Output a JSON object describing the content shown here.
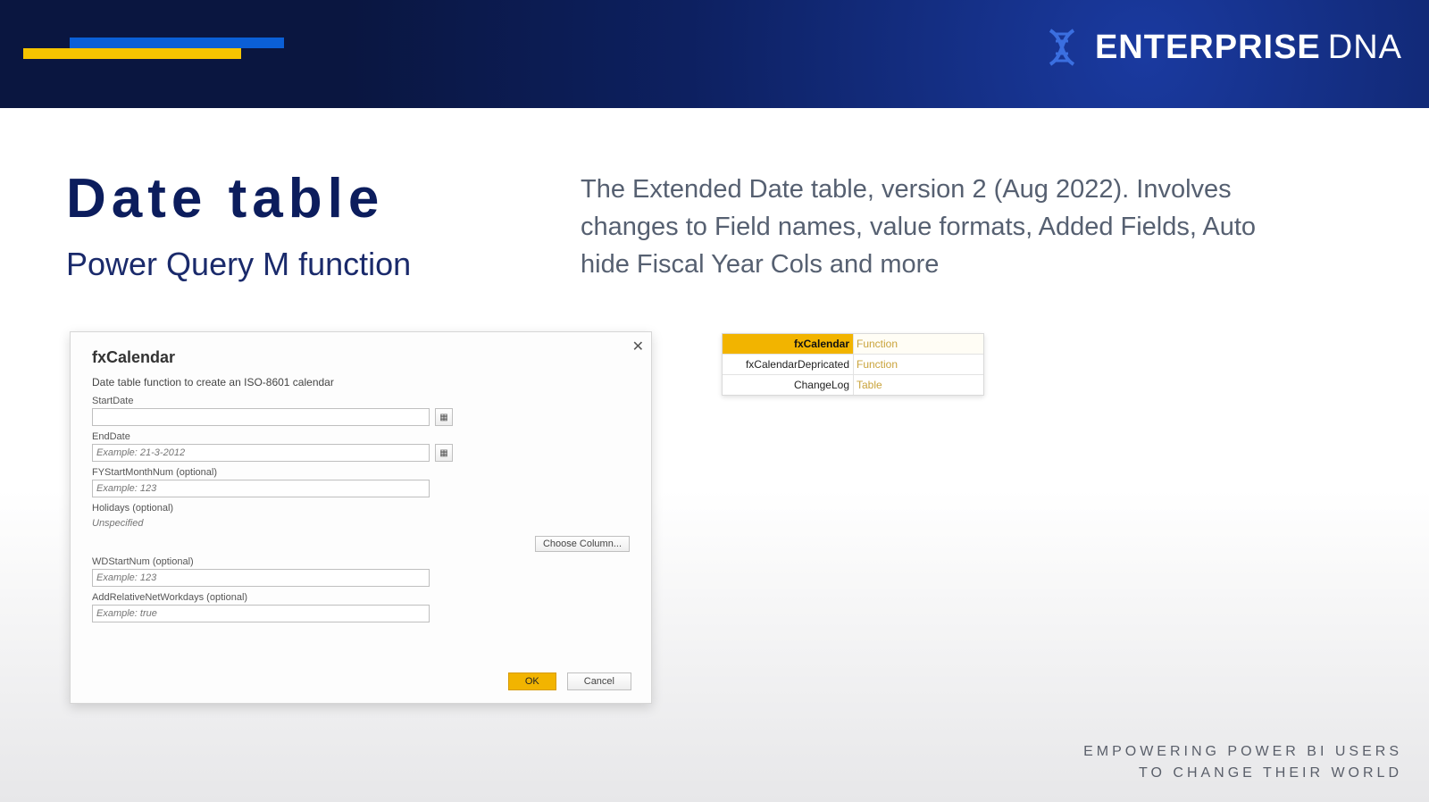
{
  "brand": {
    "name1": "ENTERPRISE",
    "name2": "DNA"
  },
  "headings": {
    "title": "Date table",
    "subtitle": "Power Query M function",
    "description": "The Extended Date table, version 2 (Aug 2022). Involves changes to Field names, value formats, Added Fields, Auto hide Fiscal Year Cols and more"
  },
  "dialog": {
    "title": "fxCalendar",
    "description": "Date table function to create an ISO-8601 calendar",
    "fields": {
      "startDate": {
        "label": "StartDate",
        "placeholder": ""
      },
      "endDate": {
        "label": "EndDate",
        "placeholder": "Example: 21-3-2012"
      },
      "fyStart": {
        "label": "FYStartMonthNum (optional)",
        "placeholder": "Example: 123"
      },
      "holidays": {
        "label": "Holidays (optional)",
        "placeholder": "Unspecified"
      },
      "wdStart": {
        "label": "WDStartNum (optional)",
        "placeholder": "Example: 123"
      },
      "addRel": {
        "label": "AddRelativeNetWorkdays (optional)",
        "placeholder": "Example: true"
      }
    },
    "buttons": {
      "choose": "Choose Column...",
      "ok": "OK",
      "cancel": "Cancel"
    }
  },
  "queries": [
    {
      "name": "fxCalendar",
      "type": "Function",
      "selected": true
    },
    {
      "name": "fxCalendarDepricated",
      "type": "Function",
      "selected": false
    },
    {
      "name": "ChangeLog",
      "type": "Table",
      "selected": false
    }
  ],
  "tagline": {
    "line1": "EMPOWERING POWER BI USERS",
    "line2": "TO CHANGE THEIR WORLD"
  }
}
